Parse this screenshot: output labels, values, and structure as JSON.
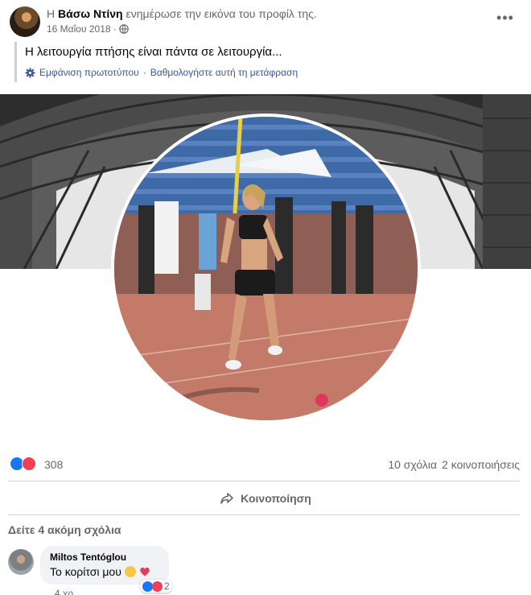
{
  "post": {
    "prefix": "Η",
    "author": "Βάσω Ντίνη",
    "action": "ενημέρωσε την εικόνα του προφίλ της.",
    "date": "16 Μαΐου 2018 ·",
    "privacy_icon": "globe-icon",
    "more_icon": "more-icon",
    "more_glyph": "•••"
  },
  "translation": {
    "text": "Η λειτουργία πτήσης είναι πάντα σε λειτουργία...",
    "show_original": "Εμφάνιση πρωτοτύπου",
    "separator": "·",
    "rate": "Βαθμολογήστε αυτή τη μετάφραση"
  },
  "reactions": {
    "count": "308",
    "comments": "10 σχόλια",
    "shares": "2 κοινοποιήσεις"
  },
  "actions": {
    "share": "Κοινοποίηση"
  },
  "comments": {
    "view_more": "Δείτε 4 ακόμη σχόλια",
    "items": [
      {
        "author": "Miltos Tentóglou",
        "text": "Το κορίτσι μου",
        "reaction_count": "2",
        "time": "4 χρ"
      }
    ]
  },
  "colors": {
    "link": "#385898",
    "like": "#1877f2",
    "love": "#f33e58",
    "secondary_text": "#65676b"
  }
}
